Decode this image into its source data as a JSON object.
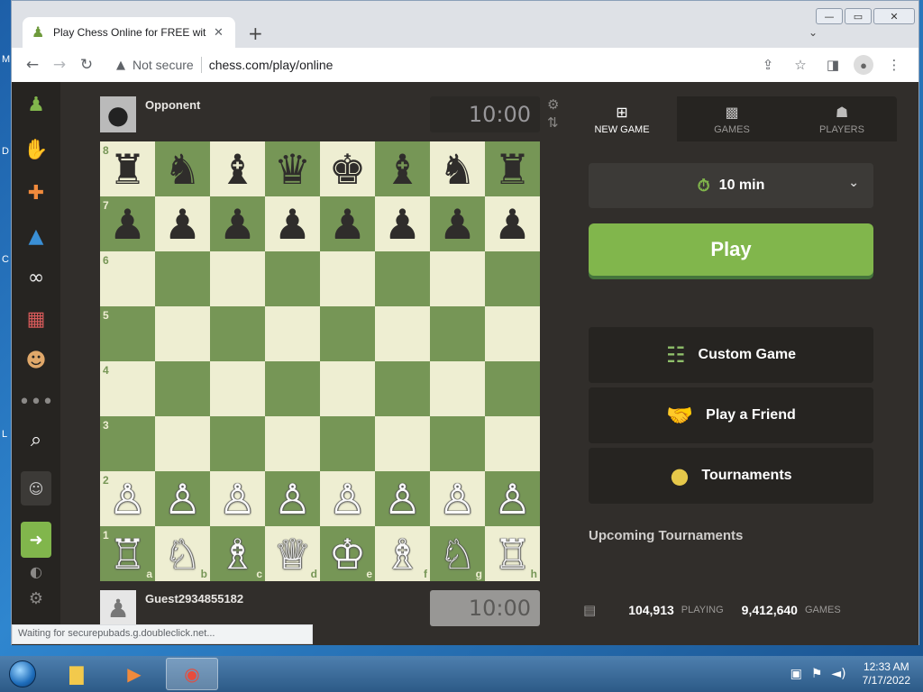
{
  "browser": {
    "tab_title": "Play Chess Online for FREE with F",
    "new_tab": "+",
    "tab_close": "✕",
    "not_secure": "Not secure",
    "url": "chess.com/play/online",
    "status": "Waiting for securepubads.g.doubleclick.net..."
  },
  "players": {
    "opponent": {
      "name": "Opponent",
      "clock": "10:00"
    },
    "me": {
      "name": "Guest2934855182",
      "clock": "10:00"
    }
  },
  "board": {
    "ranks": [
      "8",
      "7",
      "6",
      "5",
      "4",
      "3",
      "2",
      "1"
    ],
    "files": [
      "a",
      "b",
      "c",
      "d",
      "e",
      "f",
      "g",
      "h"
    ],
    "position": [
      [
        "♜",
        "♞",
        "♝",
        "♛",
        "♚",
        "♝",
        "♞",
        "♜"
      ],
      [
        "♟",
        "♟",
        "♟",
        "♟",
        "♟",
        "♟",
        "♟",
        "♟"
      ],
      [
        "",
        "",
        "",
        "",
        "",
        "",
        "",
        ""
      ],
      [
        "",
        "",
        "",
        "",
        "",
        "",
        "",
        ""
      ],
      [
        "",
        "",
        "",
        "",
        "",
        "",
        "",
        ""
      ],
      [
        "",
        "",
        "",
        "",
        "",
        "",
        "",
        ""
      ],
      [
        "♙",
        "♙",
        "♙",
        "♙",
        "♙",
        "♙",
        "♙",
        "♙"
      ],
      [
        "♖",
        "♘",
        "♗",
        "♕",
        "♔",
        "♗",
        "♘",
        "♖"
      ]
    ]
  },
  "panel": {
    "tabs": [
      {
        "label": "NEW GAME",
        "icon": "plus-square-icon",
        "active": true
      },
      {
        "label": "GAMES",
        "icon": "checkerboard-icon",
        "active": false
      },
      {
        "label": "PLAYERS",
        "icon": "people-icon",
        "active": false
      }
    ],
    "time_control": "10 min",
    "play_label": "Play",
    "options": [
      {
        "label": "Custom Game",
        "icon": "sliders-icon"
      },
      {
        "label": "Play a Friend",
        "icon": "handshake-icon"
      },
      {
        "label": "Tournaments",
        "icon": "medal-icon"
      }
    ],
    "upcoming": "Upcoming Tournaments",
    "stats": {
      "playing_count": "104,913",
      "playing_label": "PLAYING",
      "games_count": "9,412,640",
      "games_label": "GAMES"
    }
  },
  "colors": {
    "board_light": "#eeeed2",
    "board_dark": "#769656",
    "accent_green": "#81b64c",
    "page_bg": "#312e2b"
  },
  "taskbar": {
    "time": "12:33 AM",
    "date": "7/17/2022"
  }
}
